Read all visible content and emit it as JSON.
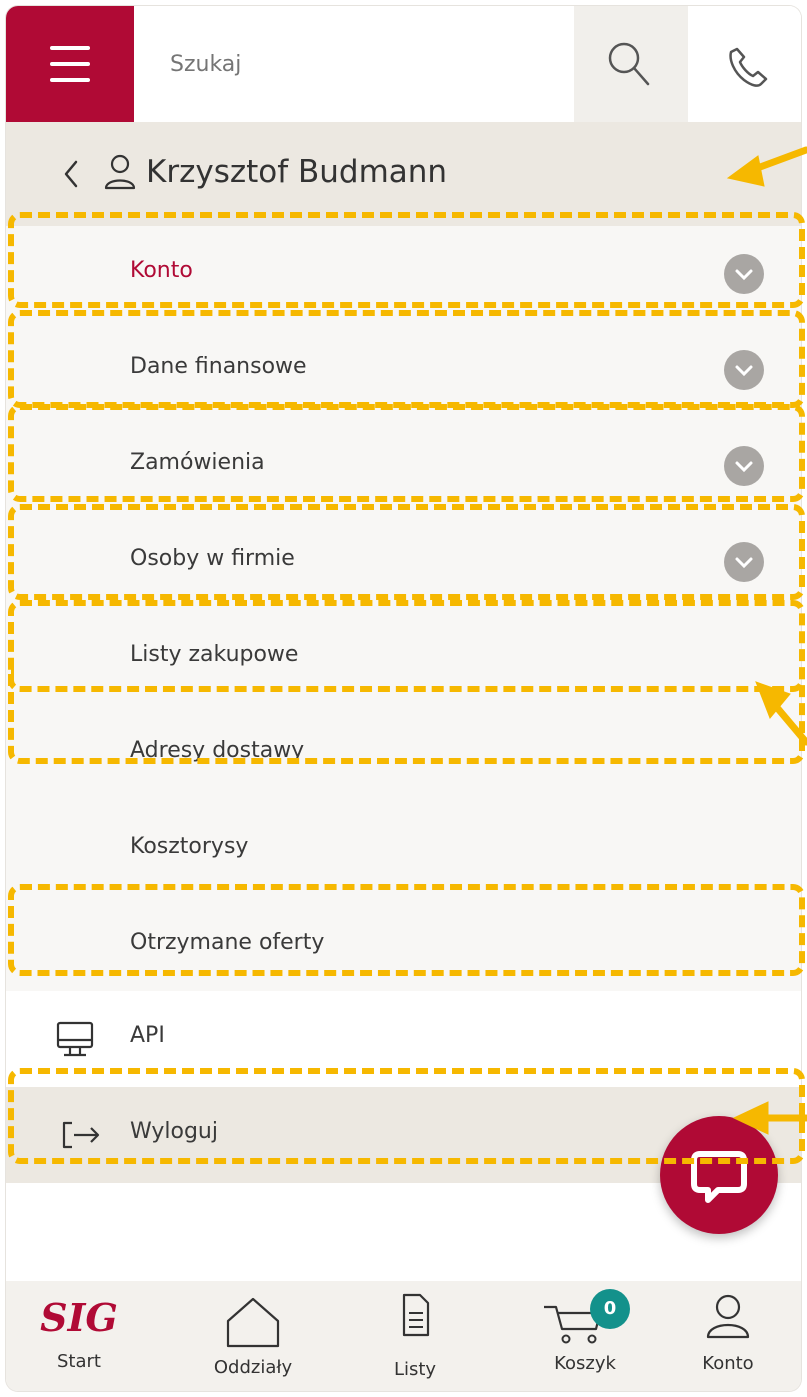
{
  "header": {
    "search_placeholder": "Szukaj"
  },
  "user": {
    "name": "Krzysztof Budmann"
  },
  "menu": {
    "items": [
      {
        "label": "Konto",
        "active": true,
        "expandable": true
      },
      {
        "label": "Dane finansowe",
        "expandable": true
      },
      {
        "label": "Zamówienia",
        "expandable": true
      },
      {
        "label": "Osoby w firmie",
        "expandable": true
      },
      {
        "label": "Listy zakupowe",
        "expandable": false
      },
      {
        "label": "Adresy dostawy",
        "expandable": false
      },
      {
        "label": "Kosztorysy",
        "expandable": false
      },
      {
        "label": "Otrzymane oferty",
        "expandable": false
      }
    ],
    "api_label": "API",
    "logout_label": "Wyloguj"
  },
  "bottom_nav": {
    "start": "Start",
    "branches": "Oddziały",
    "lists": "Listy",
    "cart": "Koszyk",
    "account": "Konto",
    "cart_count": "0",
    "logo_text": "SIG"
  },
  "colors": {
    "brand": "#b00a35",
    "annotation": "#f6b800",
    "badge": "#13918b"
  }
}
